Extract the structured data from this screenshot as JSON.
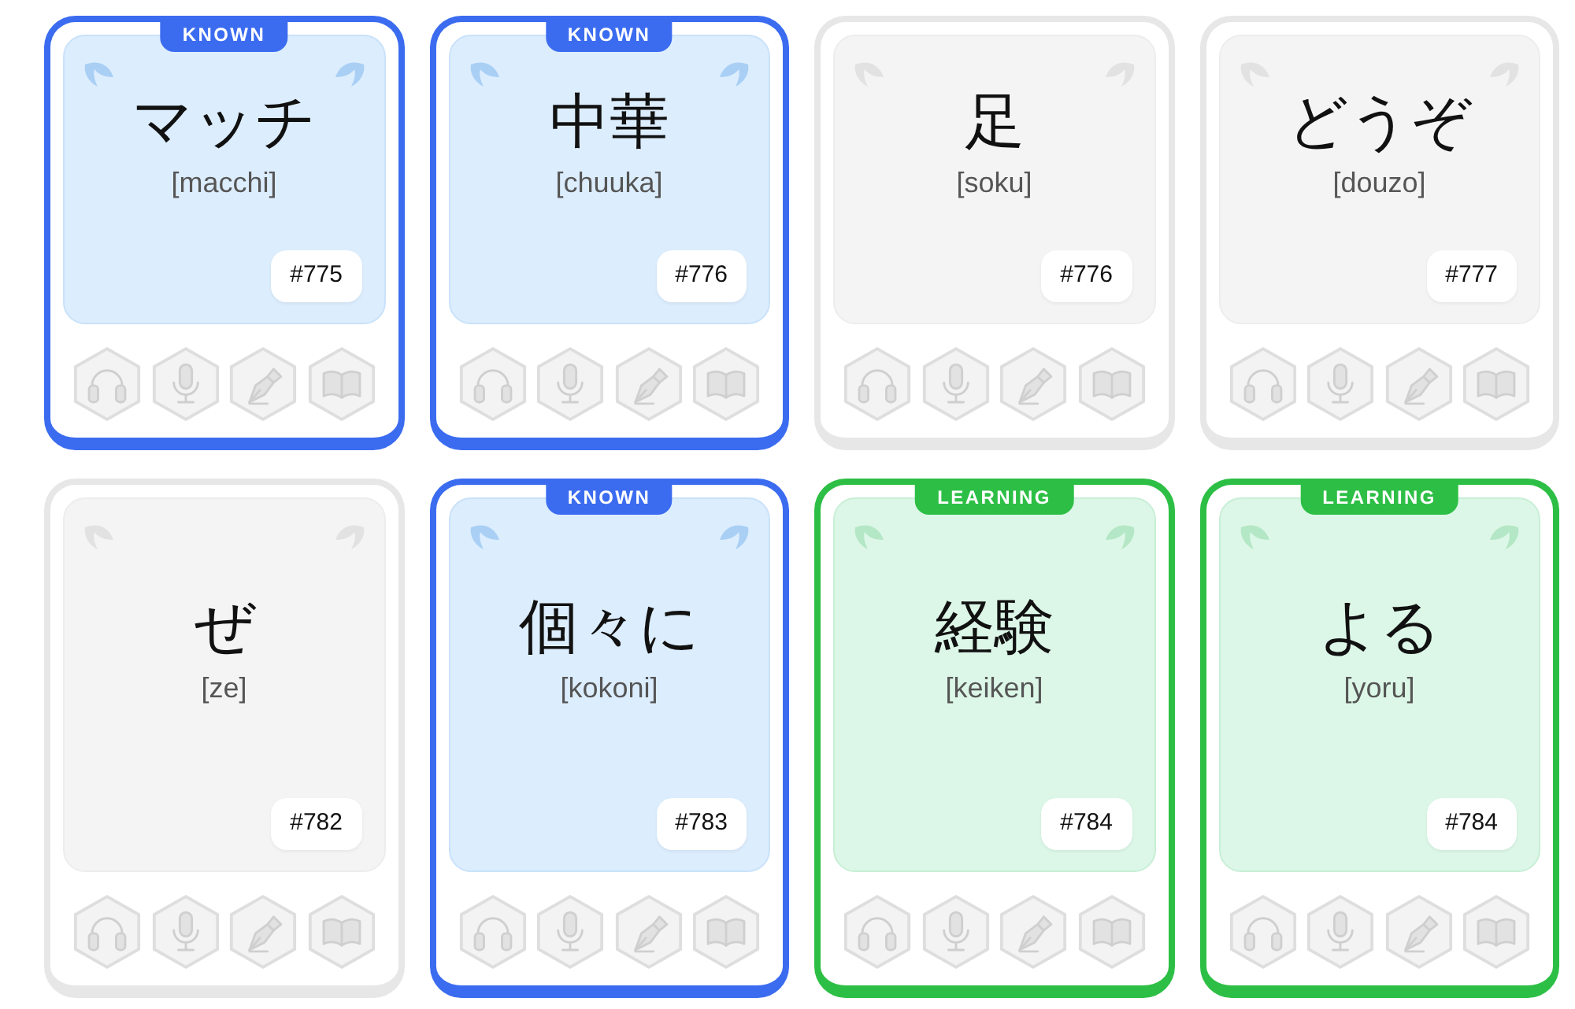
{
  "cards": [
    {
      "kind": "known",
      "badge": "KNOWN",
      "word": "マッチ",
      "reading": "[macchi]",
      "number": "#775"
    },
    {
      "kind": "known",
      "badge": "KNOWN",
      "word": "中華",
      "reading": "[chuuka]",
      "number": "#776"
    },
    {
      "kind": "plain",
      "word": "足",
      "reading": "[soku]",
      "number": "#776"
    },
    {
      "kind": "plain",
      "word": "どうぞ",
      "reading": "[douzo]",
      "number": "#777"
    },
    {
      "kind": "plain",
      "word": "ぜ",
      "reading": "[ze]",
      "number": "#782"
    },
    {
      "kind": "known",
      "badge": "KNOWN",
      "word": "個々に",
      "reading": "[kokoni]",
      "number": "#783"
    },
    {
      "kind": "learning",
      "badge": "LEARNING",
      "word": "経験",
      "reading": "[keiken]",
      "number": "#784"
    },
    {
      "kind": "learning",
      "badge": "LEARNING",
      "word": "よる",
      "reading": "[yoru]",
      "number": "#784"
    }
  ]
}
